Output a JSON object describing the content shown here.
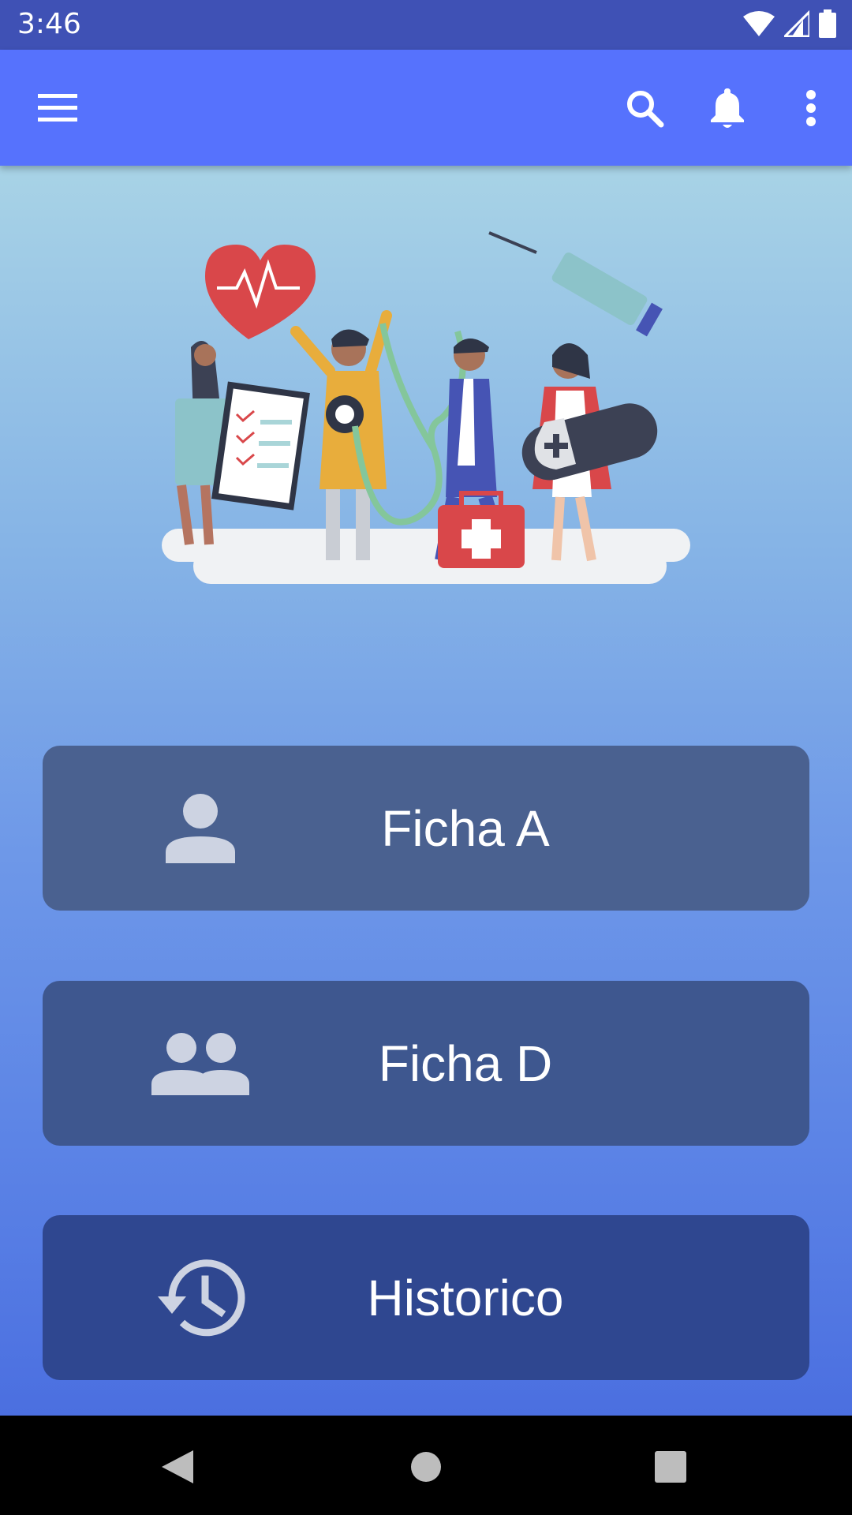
{
  "status_bar": {
    "time": "3:46"
  },
  "app_bar": {
    "menu_icon": "hamburger-menu-icon",
    "search_icon": "search-icon",
    "notifications_icon": "bell-icon",
    "overflow_icon": "more-vert-icon"
  },
  "hero": {
    "illustration": "medical-team-illustration"
  },
  "menu": [
    {
      "label": "Ficha A",
      "icon": "person-icon"
    },
    {
      "label": "Ficha D",
      "icon": "group-icon"
    },
    {
      "label": "Historico",
      "icon": "history-icon"
    }
  ],
  "nav_bar": {
    "back": "back-icon",
    "home": "home-icon",
    "recents": "recents-icon"
  },
  "colors": {
    "status_bar": "#3f51b5",
    "app_bar": "#5672fd",
    "card_a": "#4a6190",
    "card_d": "#3e578f",
    "card_h": "#2f4790"
  }
}
